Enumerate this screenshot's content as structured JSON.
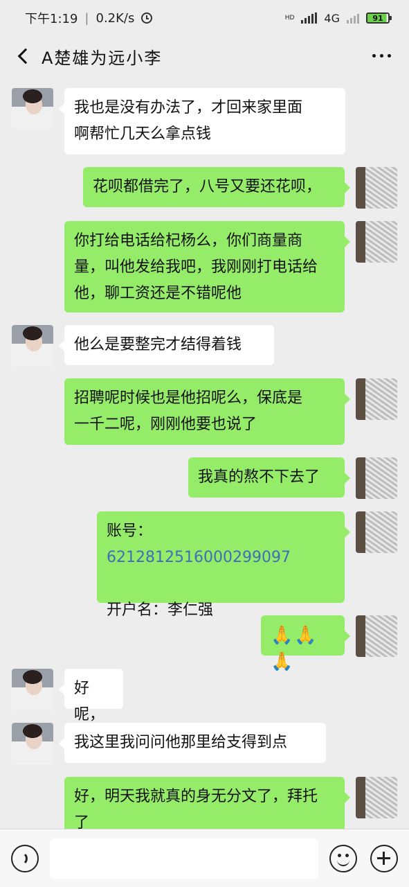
{
  "status_bar": {
    "time": "下午1:19",
    "separator": "|",
    "net_speed": "0.2K/s",
    "hd_label": "HD",
    "network": "4G",
    "battery": "91"
  },
  "header": {
    "title": "A楚雄为远小李"
  },
  "messages": [
    {
      "sender": "them",
      "text_lines": [
        "我也是没有办法了，才回来家里面",
        "啊帮忙几天么拿点钱"
      ]
    },
    {
      "sender": "me",
      "text_lines": [
        "花呗都借完了，八号又要还花呗，"
      ]
    },
    {
      "sender": "me",
      "text_lines": [
        "你打给电话给杞杨么，你们商量商",
        "量，叫他发给我吧，我刚刚打电话给",
        "他，聊工资还是不错呢他"
      ]
    },
    {
      "sender": "them",
      "text_lines": [
        "他么是要整完才结得着钱"
      ]
    },
    {
      "sender": "me",
      "text_lines": [
        "招聘呢时候也是他招呢么，保底是",
        "一千二呢，刚刚他要也说了"
      ]
    },
    {
      "sender": "me",
      "text_lines": [
        "我真的熬不下去了"
      ]
    },
    {
      "sender": "me",
      "account_label": "账号：",
      "account_number": "6212812516000299097",
      "name_label": "开户名：李仁强"
    },
    {
      "sender": "me",
      "text_lines": [
        "🙏🙏🙏"
      ]
    },
    {
      "sender": "them",
      "text_lines": [
        "好呢，"
      ]
    },
    {
      "sender": "them",
      "text_lines": [
        "我这里我问问他那里给支得到点"
      ]
    },
    {
      "sender": "me",
      "text_lines": [
        "好，明天我就真的身无分文了，拜托",
        "了"
      ]
    }
  ],
  "input_bar": {
    "placeholder": ""
  },
  "colors": {
    "background": "#ededed",
    "my_bubble": "#95ec69",
    "their_bubble": "#ffffff",
    "link": "#3f6fb5"
  },
  "icons": [
    "back-icon",
    "more-icon",
    "voice-icon",
    "emoji-icon",
    "plus-icon"
  ]
}
